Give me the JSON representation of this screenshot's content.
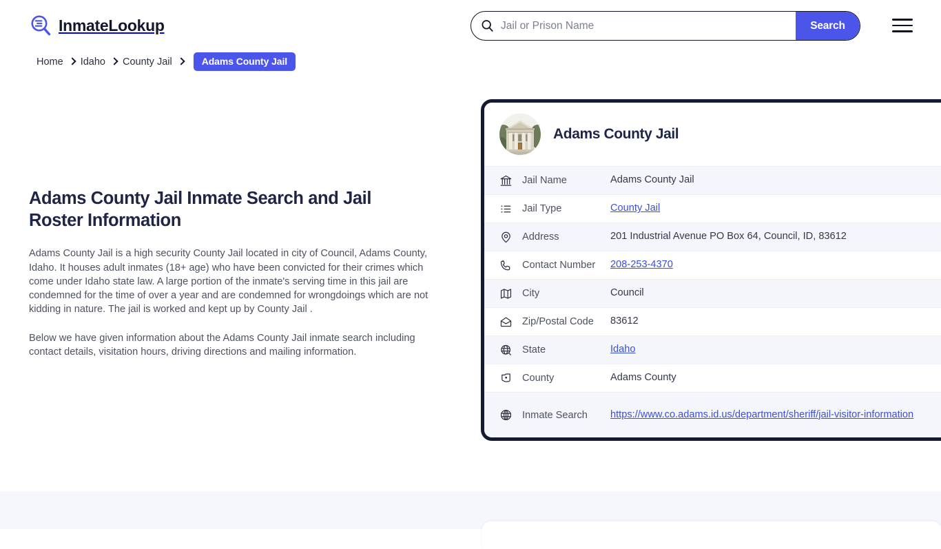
{
  "header": {
    "brand_name": "InmateLookup",
    "brand_icon": "magnifier-list-icon",
    "search": {
      "placeholder": "Jail or Prison Name",
      "value": "",
      "icon": "search-icon",
      "button_label": "Search"
    },
    "menu_icon": "hamburger-menu-icon"
  },
  "breadcrumb": {
    "items": [
      {
        "label": "Home",
        "current": false
      },
      {
        "label": "Idaho",
        "current": false
      },
      {
        "label": "County Jail",
        "current": false
      },
      {
        "label": "Adams County Jail",
        "current": true
      }
    ]
  },
  "main": {
    "title": "Adams County Jail Inmate Search and Jail Roster Information",
    "paragraphs": [
      "Adams County Jail is a high security County Jail located in city of Council, Adams County, Idaho. It houses adult inmates (18+ age) who have been convicted for their crimes which come under Idaho state law. A large portion of the inmate's serving time in this jail are condemned for the time of over a year and are condemned for wrongdoings which are not kidding in nature. The jail is worked and kept up by County Jail .",
      "Below we have given information about the Adams County Jail inmate search including contact details, visitation hours, driving directions and mailing information."
    ]
  },
  "card": {
    "avatar_icon": "courthouse-photo",
    "title": "Adams County Jail",
    "rows": [
      {
        "icon": "bank-icon",
        "label": "Jail Name",
        "value": "Adams County Jail",
        "link": false
      },
      {
        "icon": "list-icon",
        "label": "Jail Type",
        "value": "County Jail",
        "link": true
      },
      {
        "icon": "map-pin-icon",
        "label": "Address",
        "value": "201 Industrial Avenue PO Box 64, Council, ID, 83612",
        "link": false
      },
      {
        "icon": "phone-icon",
        "label": "Contact Number",
        "value": "208-253-4370",
        "link": true
      },
      {
        "icon": "map-icon",
        "label": "City",
        "value": "Council",
        "link": false
      },
      {
        "icon": "envelope-icon",
        "label": "Zip/Postal Code",
        "value": "83612",
        "link": false
      },
      {
        "icon": "globe-stand-icon",
        "label": "State",
        "value": "Idaho",
        "link": true
      },
      {
        "icon": "shield-icon",
        "label": "County",
        "value": "Adams County",
        "link": false
      },
      {
        "icon": "globe-icon",
        "label": "Inmate Search",
        "value": "https://www.co.adams.id.us/department/sheriff/jail-visitor-information",
        "link": true
      }
    ]
  },
  "colors": {
    "accent": "#4b55ea",
    "ink": "#151a33",
    "link": "#3b4fd8",
    "row_alt": "#f5f6fc",
    "band": "#f6f6fd"
  }
}
